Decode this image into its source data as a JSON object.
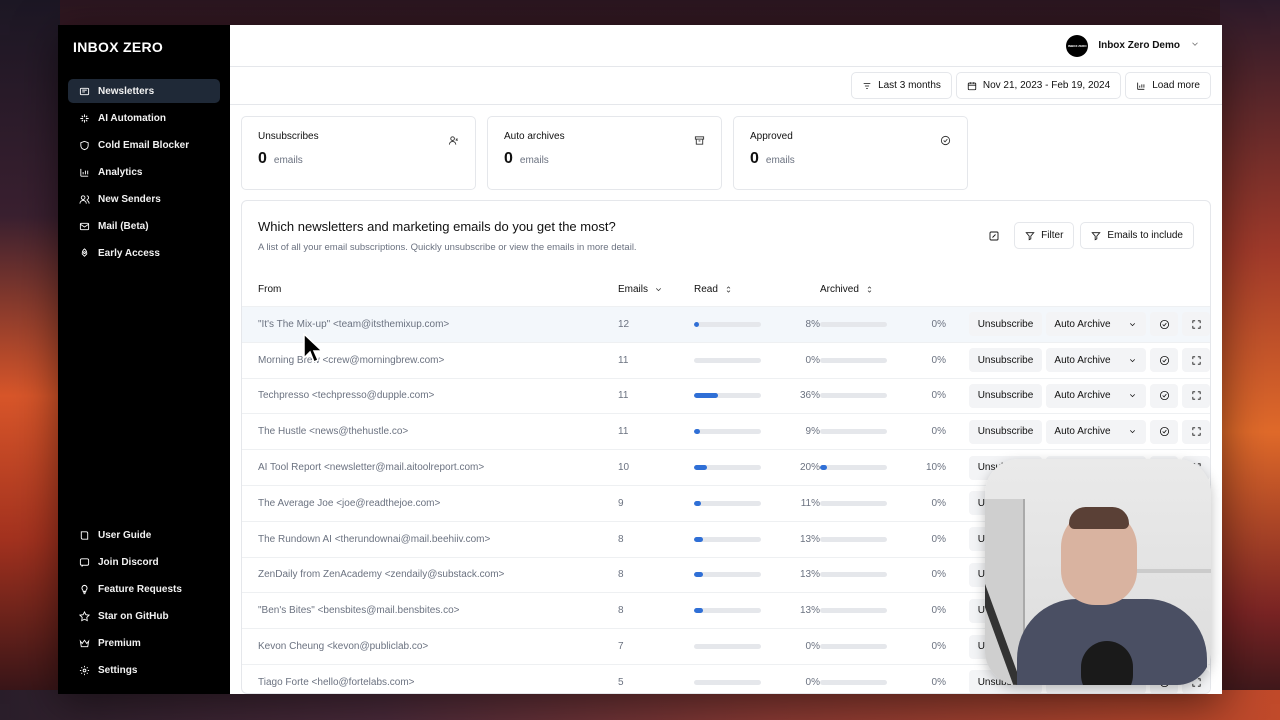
{
  "app": {
    "logo": "INBOX ZERO"
  },
  "sidebar": {
    "items": [
      {
        "label": "Newsletters",
        "icon": "newspaper-icon",
        "active": true
      },
      {
        "label": "AI Automation",
        "icon": "sparkles-icon",
        "active": false
      },
      {
        "label": "Cold Email Blocker",
        "icon": "shield-icon",
        "active": false
      },
      {
        "label": "Analytics",
        "icon": "bar-chart-icon",
        "active": false
      },
      {
        "label": "New Senders",
        "icon": "users-icon",
        "active": false
      },
      {
        "label": "Mail (Beta)",
        "icon": "mail-icon",
        "active": false
      },
      {
        "label": "Early Access",
        "icon": "rocket-icon",
        "active": false
      }
    ],
    "bottom_items": [
      {
        "label": "User Guide",
        "icon": "book-icon"
      },
      {
        "label": "Join Discord",
        "icon": "message-icon"
      },
      {
        "label": "Feature Requests",
        "icon": "lightbulb-icon"
      },
      {
        "label": "Star on GitHub",
        "icon": "github-icon"
      },
      {
        "label": "Premium",
        "icon": "crown-icon"
      },
      {
        "label": "Settings",
        "icon": "gear-icon"
      }
    ]
  },
  "header": {
    "account_name": "Inbox Zero Demo",
    "avatar_text": "INBOX ZERO"
  },
  "toolbar": {
    "range_label": "Last 3 months",
    "date_range": "Nov 21, 2023 - Feb 19, 2024",
    "load_more": "Load more"
  },
  "stats": [
    {
      "title": "Unsubscribes",
      "value": "0",
      "unit": "emails",
      "icon": "user-x-icon"
    },
    {
      "title": "Auto archives",
      "value": "0",
      "unit": "emails",
      "icon": "archive-icon"
    },
    {
      "title": "Approved",
      "value": "0",
      "unit": "emails",
      "icon": "check-circle-icon"
    }
  ],
  "card": {
    "title": "Which newsletters and marketing emails do you get the most?",
    "subtitle": "A list of all your email subscriptions. Quickly unsubscribe or view the emails in more detail.",
    "filter_label": "Filter",
    "emails_to_include_label": "Emails to include"
  },
  "table": {
    "columns": {
      "from": "From",
      "emails": "Emails",
      "read": "Read",
      "archived": "Archived"
    },
    "actions": {
      "unsubscribe": "Unsubscribe",
      "auto_archive": "Auto Archive"
    },
    "rows": [
      {
        "from": "\"It's The Mix-up\" <team@itsthemixup.com>",
        "emails": "12",
        "read_pct": 8,
        "read_label": "8%",
        "archived_pct": 0,
        "archived_label": "0%"
      },
      {
        "from": "Morning Brew <crew@morningbrew.com>",
        "emails": "11",
        "read_pct": 0,
        "read_label": "0%",
        "archived_pct": 0,
        "archived_label": "0%"
      },
      {
        "from": "Techpresso <techpresso@dupple.com>",
        "emails": "11",
        "read_pct": 36,
        "read_label": "36%",
        "archived_pct": 0,
        "archived_label": "0%"
      },
      {
        "from": "The Hustle <news@thehustle.co>",
        "emails": "11",
        "read_pct": 9,
        "read_label": "9%",
        "archived_pct": 0,
        "archived_label": "0%"
      },
      {
        "from": "AI Tool Report <newsletter@mail.aitoolreport.com>",
        "emails": "10",
        "read_pct": 20,
        "read_label": "20%",
        "archived_pct": 10,
        "archived_label": "10%"
      },
      {
        "from": "The Average Joe <joe@readthejoe.com>",
        "emails": "9",
        "read_pct": 11,
        "read_label": "11%",
        "archived_pct": 0,
        "archived_label": "0%"
      },
      {
        "from": "The Rundown AI <therundownai@mail.beehiiv.com>",
        "emails": "8",
        "read_pct": 13,
        "read_label": "13%",
        "archived_pct": 0,
        "archived_label": "0%"
      },
      {
        "from": "ZenDaily from ZenAcademy <zendaily@substack.com>",
        "emails": "8",
        "read_pct": 13,
        "read_label": "13%",
        "archived_pct": 0,
        "archived_label": "0%"
      },
      {
        "from": "\"Ben's Bites\" <bensbites@mail.bensbites.co>",
        "emails": "8",
        "read_pct": 13,
        "read_label": "13%",
        "archived_pct": 0,
        "archived_label": "0%"
      },
      {
        "from": "Kevon Cheung <kevon@publiclab.co>",
        "emails": "7",
        "read_pct": 0,
        "read_label": "0%",
        "archived_pct": 0,
        "archived_label": "0%"
      },
      {
        "from": "Tiago Forte <hello@fortelabs.com>",
        "emails": "5",
        "read_pct": 0,
        "read_label": "0%",
        "archived_pct": 0,
        "archived_label": "0%"
      }
    ]
  },
  "colors": {
    "accent": "#2f6fd6",
    "sidebar_bg": "#000000",
    "active_item_bg": "#1f2937"
  }
}
